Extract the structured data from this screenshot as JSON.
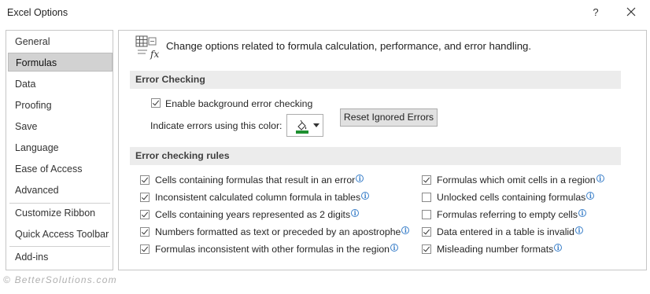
{
  "window": {
    "title": "Excel Options",
    "help_label": "?"
  },
  "sidebar": {
    "items": [
      {
        "label": "General"
      },
      {
        "label": "Formulas",
        "selected": true
      },
      {
        "label": "Data"
      },
      {
        "label": "Proofing"
      },
      {
        "label": "Save"
      },
      {
        "label": "Language"
      },
      {
        "label": "Ease of Access"
      },
      {
        "label": "Advanced"
      },
      {
        "label": "Customize Ribbon"
      },
      {
        "label": "Quick Access Toolbar"
      },
      {
        "label": "Add-ins"
      }
    ]
  },
  "header": {
    "icon": "formula-fx-icon",
    "text": "Change options related to formula calculation, performance, and error handling."
  },
  "error_checking": {
    "section_title": "Error Checking",
    "enable_label": "Enable background error checking",
    "enable_checked": true,
    "indicate_label": "Indicate errors using this color:",
    "color_picker_icon": "fill-color-icon",
    "indicator_color": "#1e8f30",
    "reset_button_label": "Reset Ignored Errors"
  },
  "rules": {
    "section_title": "Error checking rules",
    "left": [
      {
        "label": "Cells containing formulas that result in an error",
        "checked": true
      },
      {
        "label": "Inconsistent calculated column formula in tables",
        "checked": true
      },
      {
        "label": "Cells containing years represented as 2 digits",
        "checked": true
      },
      {
        "label": "Numbers formatted as text or preceded by an apostrophe",
        "checked": true
      },
      {
        "label": "Formulas inconsistent with other formulas in the region",
        "checked": true
      }
    ],
    "right": [
      {
        "label": "Formulas which omit cells in a region",
        "checked": true
      },
      {
        "label": "Unlocked cells containing formulas",
        "checked": false
      },
      {
        "label": "Formulas referring to empty cells",
        "checked": false
      },
      {
        "label": "Data entered in a table is invalid",
        "checked": true
      },
      {
        "label": "Misleading number formats",
        "checked": true
      }
    ]
  },
  "watermark": "© BetterSolutions.com",
  "colors": {
    "info_icon": "#3a7fc9",
    "section_bar": "#ececec",
    "selected_nav": "#d2d2d2"
  }
}
